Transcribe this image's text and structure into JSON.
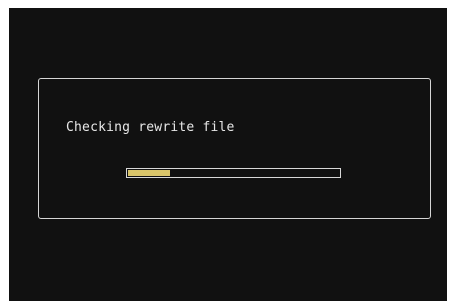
{
  "dialog": {
    "message": "Checking rewrite file",
    "progress_fraction": 0.2,
    "progress_color": "#d9c56a"
  }
}
